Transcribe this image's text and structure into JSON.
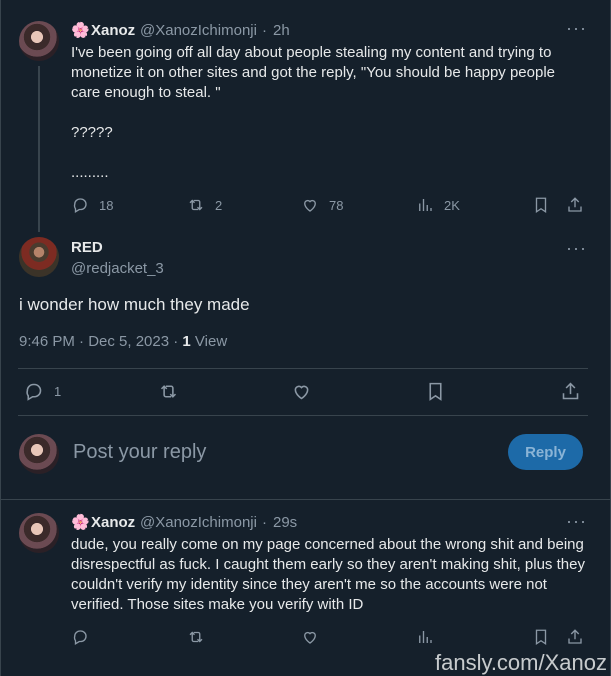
{
  "first_tweet": {
    "display_name": "Xanoz",
    "handle": "@XanozIchimonji",
    "time": "2h",
    "text": "I've been going off all day about people stealing my content and trying to monetize it on other sites and got the reply, \"You should be happy people care enough to steal. \"\n\n?????\n\n.........",
    "replies": "18",
    "reposts": "2",
    "likes": "78",
    "views": "2K"
  },
  "main_tweet": {
    "display_name": "RED",
    "handle": "@redjacket_3",
    "text": "i wonder how much they made",
    "timestamp": "9:46 PM · Dec 5, 2023 · ",
    "view_count": "1",
    "view_label": " View",
    "replies": "1"
  },
  "composer": {
    "placeholder": "Post your reply",
    "reply_label": "Reply"
  },
  "reply_tweet": {
    "display_name": "Xanoz",
    "handle": "@XanozIchimonji",
    "time": "29s",
    "text": "dude, you really come on my page concerned about the wrong shit and being disrespectful as fuck. I caught them early so they aren't making shit, plus they couldn't verify my identity since they aren't me so the accounts were not verified. Those sites make you verify with ID"
  },
  "misc": {
    "separator": "·",
    "more_glyph": "···",
    "flower_glyph": "🌸",
    "watermark": "fansly.com/Xanoz"
  }
}
